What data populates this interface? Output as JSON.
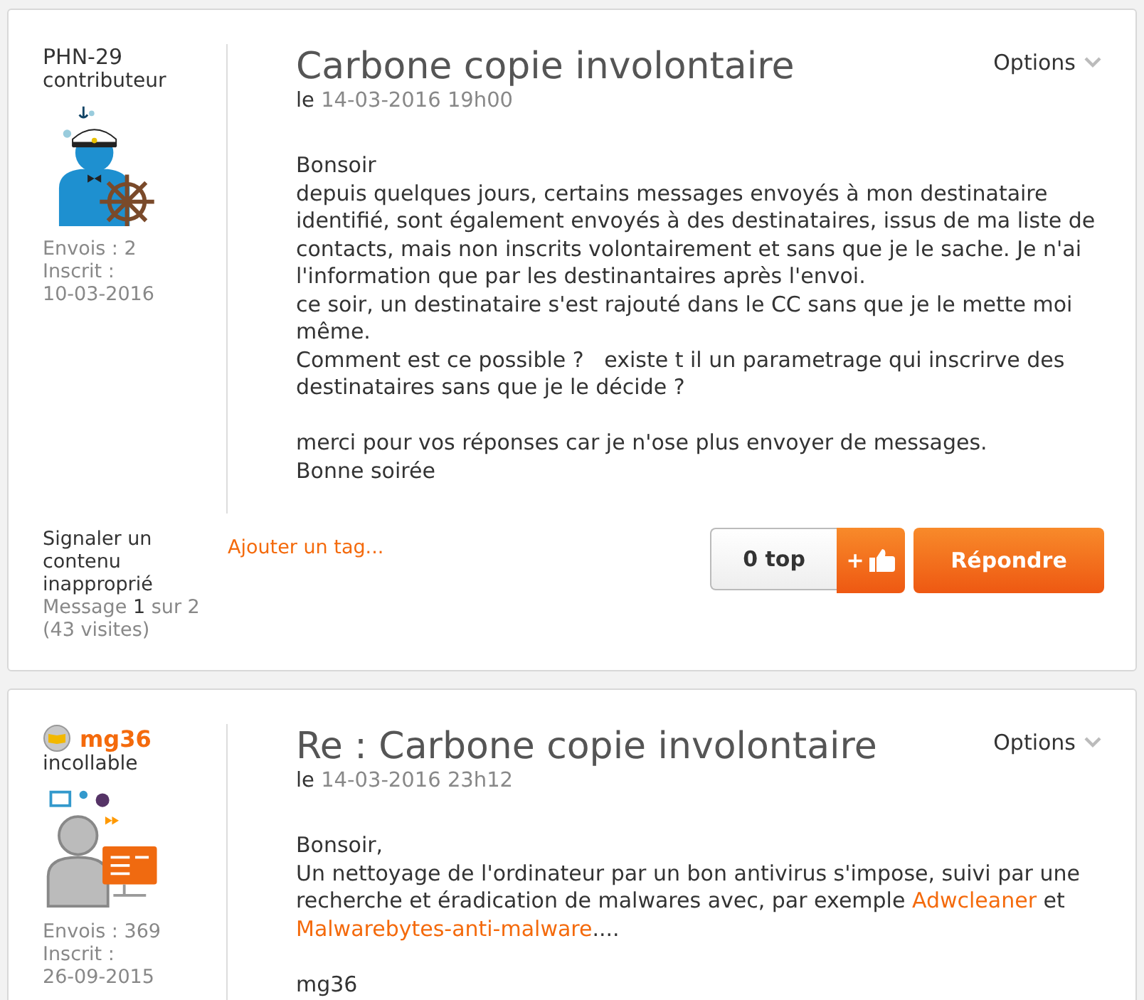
{
  "posts": [
    {
      "author": {
        "name": "PHN-29",
        "kind": "member",
        "rank": "contributeur",
        "posts_count": "Envois : 2",
        "registered_label": "Inscrit :",
        "registered_date": "10-03-2016"
      },
      "title": "Carbone copie involontaire",
      "date_prefix": "le",
      "date": "14-03-2016 19h00",
      "options": "Options",
      "body": [
        [
          {
            "kind": "text",
            "text": "Bonsoir"
          }
        ],
        [
          {
            "kind": "text",
            "text": "depuis quelques jours, certains messages envoyés à mon destinataire identifié, sont également envoyés à des destinataires, issus de ma liste de contacts, mais non inscrits volontairement et sans que je le sache. Je n'ai l'information que par les destinantaires après l'envoi."
          }
        ],
        [
          {
            "kind": "text",
            "text": "ce soir, un destinataire s'est rajouté dans le CC sans que je le mette moi même."
          }
        ],
        [
          {
            "kind": "text",
            "text": "Comment est ce possible ?   existe t il un parametrage qui inscrirve des destinataires sans que je le décide ?"
          }
        ],
        {
          "gap_before": true,
          "segments": [
            {
              "kind": "text",
              "text": "merci pour vos réponses car je n'ose plus envoyer de messages."
            }
          ]
        },
        [
          {
            "kind": "text",
            "text": "Bonne soirée"
          }
        ]
      ],
      "footer": {
        "report": "Signaler un contenu inapproprié",
        "message_prefix": "Message",
        "message_index": "1",
        "message_suffix": "sur 2",
        "visits": "(43 visites)",
        "tag_link": "Ajouter un tag...",
        "top_count": "0 top",
        "plus_sign": "+",
        "reply": "Répondre"
      }
    },
    {
      "author": {
        "name": "mg36",
        "kind": "expert",
        "rank": "incollable",
        "posts_count": "Envois : 369",
        "registered_label": "Inscrit :",
        "registered_date": "26-09-2015"
      },
      "title": "Re : Carbone copie involontaire",
      "date_prefix": "le",
      "date": "14-03-2016 23h12",
      "options": "Options",
      "body": [
        [
          {
            "kind": "text",
            "text": "Bonsoir,"
          }
        ],
        [
          {
            "kind": "text",
            "text": "Un nettoyage de l'ordinateur par un bon antivirus s'impose, suivi par une recherche et éradication de malwares avec, par exemple "
          },
          {
            "kind": "link",
            "text": "Adwcleaner"
          },
          {
            "kind": "text",
            "text": " et "
          },
          {
            "kind": "link",
            "text": "Malwarebytes-anti-malware"
          },
          {
            "kind": "text",
            "text": "...."
          }
        ],
        {
          "gap_before": true,
          "segments": [
            {
              "kind": "text",
              "text": "mg36"
            }
          ]
        }
      ]
    }
  ]
}
